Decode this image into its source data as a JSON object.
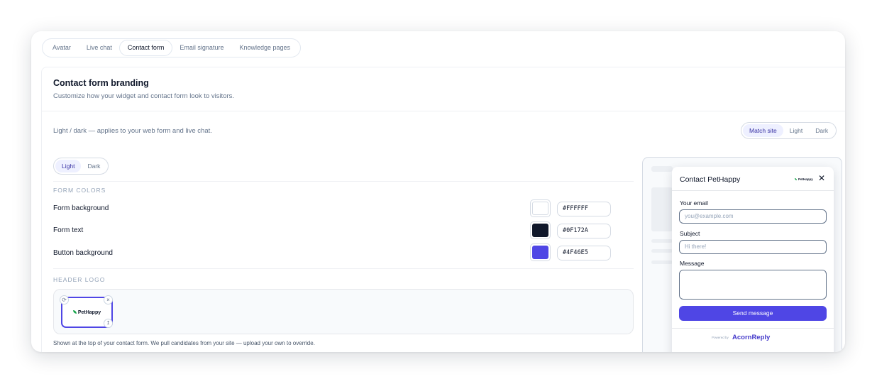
{
  "tabs": [
    {
      "label": "Avatar",
      "active": false
    },
    {
      "label": "Live chat",
      "active": false
    },
    {
      "label": "Contact form",
      "active": true
    },
    {
      "label": "Email signature",
      "active": false
    },
    {
      "label": "Knowledge pages",
      "active": false
    }
  ],
  "header": {
    "title": "Contact form branding",
    "subtitle": "Customize how your widget and contact form look to visitors."
  },
  "mode": {
    "label": "Light / dark — applies to your web form and live chat.",
    "options": [
      "Match site",
      "Light",
      "Dark"
    ],
    "selected": "Match site"
  },
  "theme_toggle": {
    "options": [
      "Light",
      "Dark"
    ],
    "selected": "Light"
  },
  "form_colors": {
    "heading": "FORM COLORS",
    "rows": [
      {
        "label": "Form background",
        "hex": "#FFFFFF",
        "color": "#ffffff"
      },
      {
        "label": "Form text",
        "hex": "#0F172A",
        "color": "#0f172a"
      },
      {
        "label": "Button background",
        "hex": "#4F46E5",
        "color": "#4f46e5"
      }
    ]
  },
  "header_logo": {
    "heading": "HEADER LOGO",
    "logo_text": "PetHappy",
    "note": "Shown at the top of your contact form. We pull candidates from your site — upload your own to override.",
    "icons": [
      "refresh-icon",
      "close-icon",
      "upload-icon"
    ]
  },
  "preview": {
    "title": "Contact PetHappy",
    "brand": "PetHappy",
    "fields": {
      "email_label": "Your email",
      "email_placeholder": "you@example.com",
      "subject_label": "Subject",
      "subject_placeholder": "Hi there!",
      "message_label": "Message"
    },
    "send_label": "Send message",
    "powered_by": "Powered by",
    "powered_logo": "AcornReply"
  }
}
